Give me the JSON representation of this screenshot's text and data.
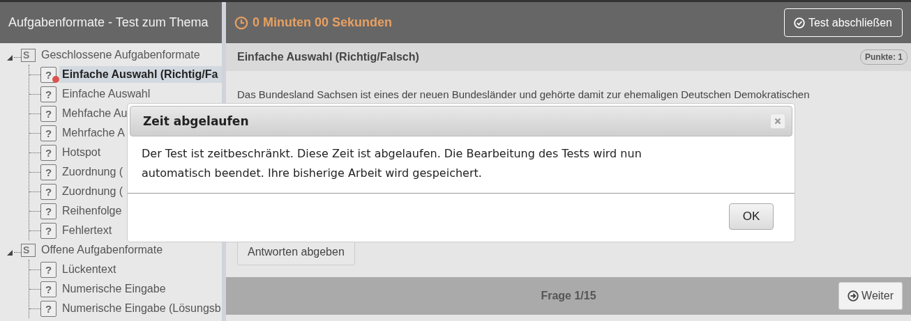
{
  "sidebar": {
    "title": "Aufgabenformate - Test zum Thema",
    "tree": [
      {
        "kind": "section",
        "icon": "S",
        "label": "Geschlossene Aufgabenformate",
        "expanded": true,
        "children": [
          {
            "icon": "?",
            "label": "Einfache Auswahl (Richtig/Fa",
            "selected": true
          },
          {
            "icon": "?",
            "label": "Einfache Auswahl",
            "selected": false
          },
          {
            "icon": "?",
            "label": "Mehfache Au",
            "selected": false
          },
          {
            "icon": "?",
            "label": "Mehrfache A",
            "selected": false
          },
          {
            "icon": "?",
            "label": "Hotspot",
            "selected": false
          },
          {
            "icon": "?",
            "label": "Zuordnung (",
            "selected": false
          },
          {
            "icon": "?",
            "label": "Zuordnung (",
            "selected": false
          },
          {
            "icon": "?",
            "label": "Reihenfolge",
            "selected": false
          },
          {
            "icon": "?",
            "label": "Fehlertext",
            "selected": false
          }
        ]
      },
      {
        "kind": "section",
        "icon": "S",
        "label": "Offene Aufgabenformate",
        "expanded": true,
        "children": [
          {
            "icon": "?",
            "label": "Lückentext",
            "selected": false
          },
          {
            "icon": "?",
            "label": "Numerische Eingabe",
            "selected": false
          },
          {
            "icon": "?",
            "label": "Numerische Eingabe (Lösungsb",
            "selected": false
          }
        ]
      }
    ]
  },
  "header": {
    "timer": "0 Minuten 00 Sekunden",
    "finish_button": "Test abschließen"
  },
  "question": {
    "title": "Einfache Auswahl (Richtig/Falsch)",
    "points": "Punkte: 1",
    "text": "Das Bundesland Sachsen ist eines der neuen Bundesländer und gehörte damit zur ehemaligen Deutschen Demokratischen",
    "submit_button": "Antworten abgeben"
  },
  "footer": {
    "counter": "Frage 1/15",
    "next_button": "Weiter"
  },
  "dialog": {
    "title": "Zeit abgelaufen",
    "message": "Der Test ist zeitbeschränkt. Diese Zeit ist abgelaufen. Die Bearbeitung des Tests wird nun automatisch beendet. Ihre bisherige Arbeit wird gespeichert.",
    "buttons": [
      "OK"
    ]
  }
}
